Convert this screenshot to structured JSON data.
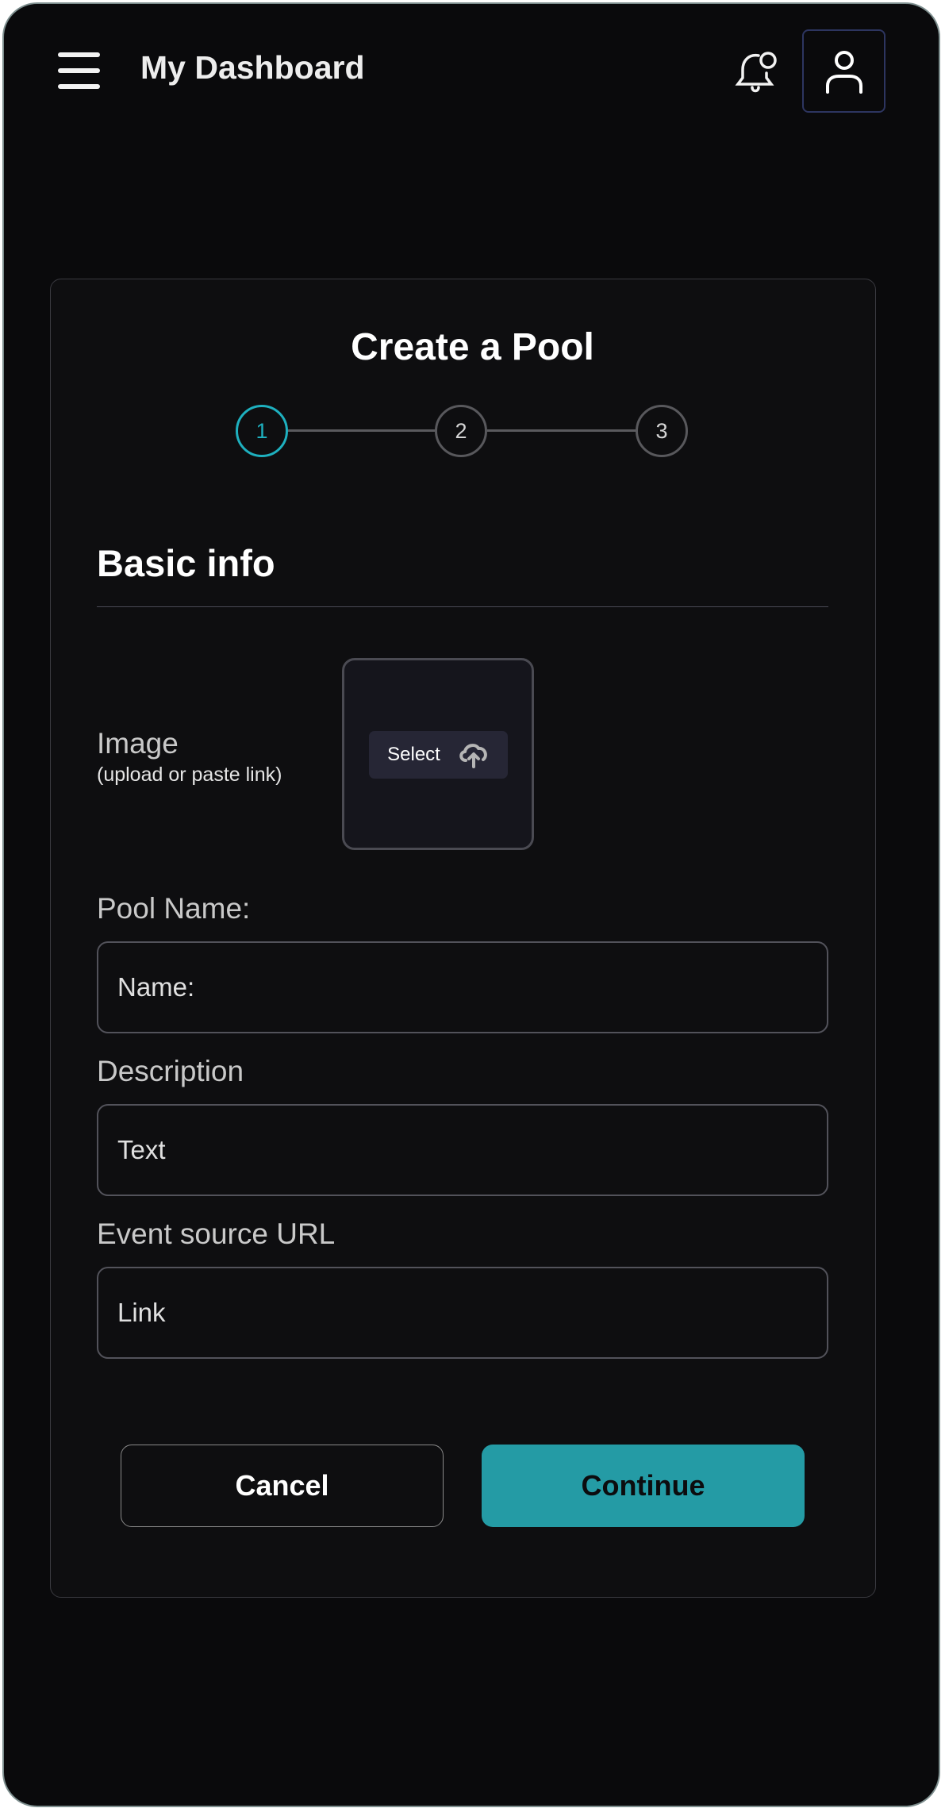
{
  "header": {
    "title": "My Dashboard",
    "menu_icon": "hamburger-icon",
    "notification_icon": "bell-icon",
    "profile_icon": "user-icon"
  },
  "card": {
    "title": "Create a Pool",
    "steps": [
      {
        "label": "1",
        "active": true
      },
      {
        "label": "2",
        "active": false
      },
      {
        "label": "3",
        "active": false
      }
    ],
    "section_title": "Basic info",
    "image": {
      "label": "Image",
      "sublabel": "(upload or paste link)",
      "select_label": "Select",
      "icon": "cloud-upload-icon"
    },
    "fields": [
      {
        "label": "Pool Name:",
        "placeholder": "Name:"
      },
      {
        "label": "Description",
        "placeholder": "Text"
      },
      {
        "label": "Event source URL",
        "placeholder": "Link"
      }
    ],
    "cancel_label": "Cancel",
    "continue_label": "Continue"
  },
  "colors": {
    "accent": "#249ba5",
    "step_active": "#1eb0bf",
    "background": "#0a0a0c",
    "card": "#0e0e10"
  }
}
